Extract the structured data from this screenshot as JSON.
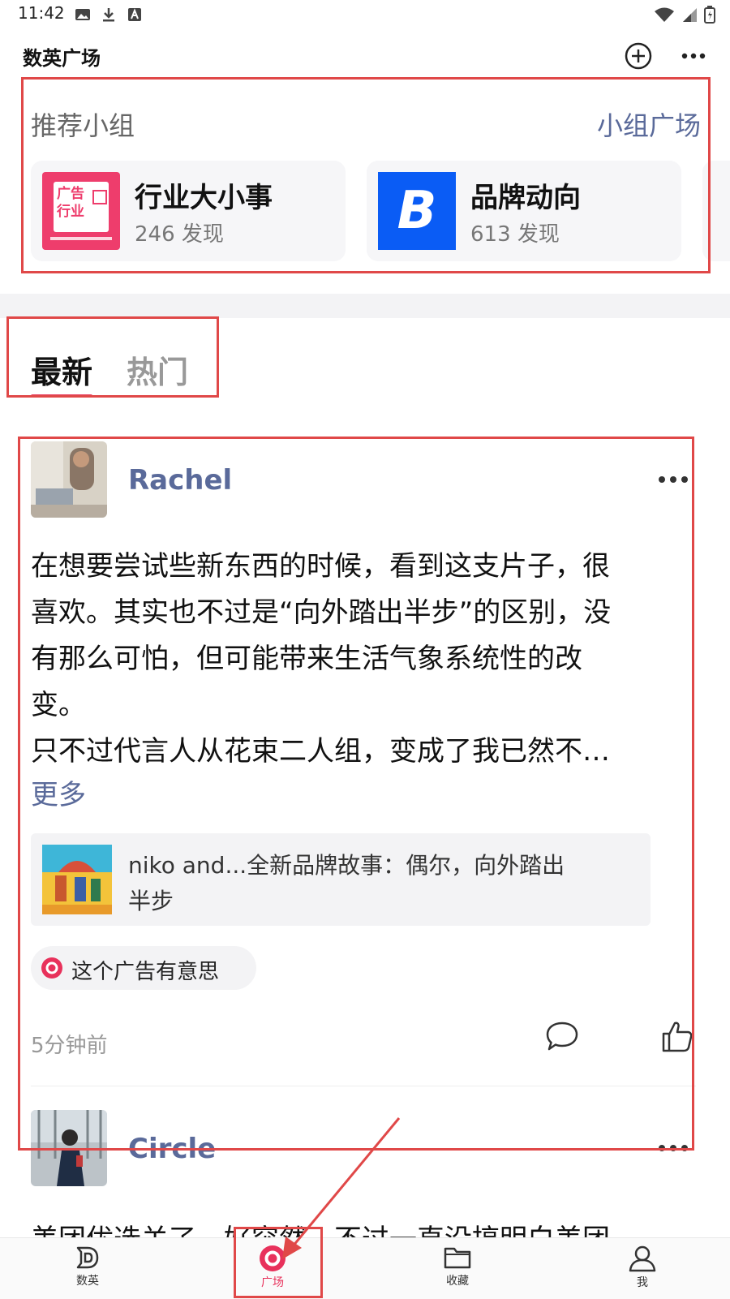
{
  "status_bar": {
    "time": "11:42"
  },
  "header": {
    "title": "数英广场",
    "add_icon": "plus-circle-icon",
    "more_icon": "more-horizontal-icon"
  },
  "groups": {
    "title": "推荐小组",
    "link": "小组广场",
    "items": [
      {
        "name": "行业大小事",
        "count": "246 发现",
        "icon": "ad-industry-icon",
        "icon_lines": [
          "广告",
          "行业"
        ],
        "color": "#ee3d6c"
      },
      {
        "name": "品牌动向",
        "count": "613 发现",
        "icon": "brand-b-icon",
        "icon_letter": "B",
        "color": "#0a5cf5"
      }
    ]
  },
  "tabs": [
    {
      "label": "最新",
      "active": true
    },
    {
      "label": "热门",
      "active": false
    }
  ],
  "posts": [
    {
      "user": "Rachel",
      "text_lines": [
        "在想要尝试些新东西的时候，看到这支片子，很",
        "喜欢。其实也不过是“向外踏出半步”的区别，没",
        "有那么可怕，但可能带来生活气象系统性的改",
        "变。",
        "只不过代言人从花束二人组，变成了我已然不…"
      ],
      "more": "更多",
      "link_card": {
        "title_line1": "niko and...全新品牌故事：偶尔，向外踏出",
        "title_line2": "半步"
      },
      "tag": "这个广告有意思",
      "time": "5分钟前"
    },
    {
      "user": "Circle",
      "text_preview": "美团优选关了，好突然。不过一直没搞明白美团"
    }
  ],
  "bottom_nav": [
    {
      "label": "数英",
      "icon": "shuying-logo-icon",
      "active": false
    },
    {
      "label": "广场",
      "icon": "square-icon",
      "active": true
    },
    {
      "label": "收藏",
      "icon": "folder-icon",
      "active": false
    },
    {
      "label": "我",
      "icon": "user-icon",
      "active": false
    }
  ],
  "colors": {
    "accent": "#e8315b",
    "link": "#5a6a9a",
    "annotation": "#e04848"
  }
}
